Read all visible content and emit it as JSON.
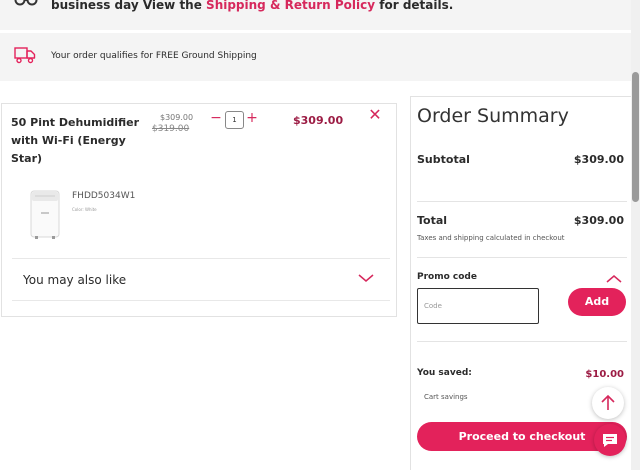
{
  "notice": {
    "text": "business day View the ",
    "link": "Shipping & Return Policy",
    "suffix": " for details."
  },
  "shipping_banner": {
    "icon": "truck-icon",
    "text": "Your order qualifies for FREE Ground Shipping"
  },
  "cart": {
    "items": [
      {
        "name": "50 Pint Dehumidifier with Wi-Fi (Energy Star)",
        "price": "$309.00",
        "original_price": "$319.00",
        "quantity": "1",
        "line_total": "$309.00",
        "sku": "FHDD5034W1",
        "color": "Color: White"
      }
    ],
    "also_like": "You may also like"
  },
  "summary": {
    "title": "Order Summary",
    "subtotal_label": "Subtotal",
    "subtotal_value": "$309.00",
    "total_label": "Total",
    "total_value": "$309.00",
    "tax_note": "Taxes and shipping calculated in checkout",
    "promo_label": "Promo code",
    "promo_placeholder": "Code",
    "add_label": "Add",
    "saved_label": "You saved:",
    "saved_value": "$10.00",
    "cart_savings": "Cart savings",
    "checkout_label": "Proceed to checkout"
  },
  "colors": {
    "accent": "#e3225b",
    "price": "#9c1c44",
    "banner_bg": "#f4f4f4"
  }
}
